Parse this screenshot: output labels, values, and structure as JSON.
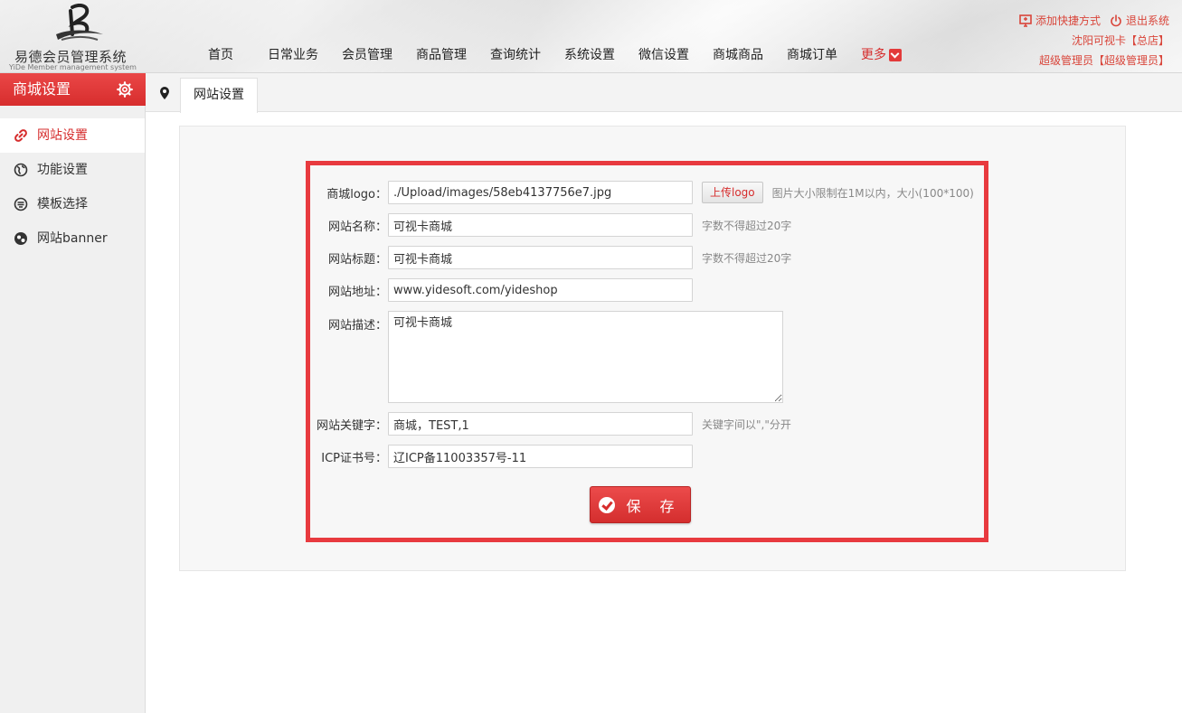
{
  "brand": {
    "name": "易德会员管理系统",
    "subtitle": "YiDe Member management system"
  },
  "nav": {
    "items": [
      "首页",
      "日常业务",
      "会员管理",
      "商品管理",
      "查询统计",
      "系统设置",
      "微信设置",
      "商城商品",
      "商城订单"
    ],
    "more_label": "更多"
  },
  "top_right": {
    "shortcut_label": "添加快捷方式",
    "logout_label": "退出系统",
    "store": "沈阳可视卡【总店】",
    "user": "超级管理员【超级管理员】"
  },
  "sidebar": {
    "title": "商城设置",
    "items": [
      {
        "label": "网站设置",
        "icon": "link-icon",
        "active": true
      },
      {
        "label": "功能设置",
        "icon": "globe-icon",
        "active": false
      },
      {
        "label": "模板选择",
        "icon": "template-icon",
        "active": false
      },
      {
        "label": "网站banner",
        "icon": "banner-icon",
        "active": false
      }
    ]
  },
  "tabs": {
    "current": "网站设置"
  },
  "form": {
    "logo": {
      "label": "商城logo：",
      "value": "./Upload/images/58eb4137756e7.jpg",
      "upload_label": "上传logo",
      "hint": "图片大小限制在1M以内，大小(100*100)"
    },
    "site_name": {
      "label": "网站名称：",
      "value": "可视卡商城",
      "hint": "字数不得超过20字"
    },
    "site_title": {
      "label": "网站标题：",
      "value": "可视卡商城",
      "hint": "字数不得超过20字"
    },
    "site_url": {
      "label": "网站地址：",
      "value": "www.yidesoft.com/yideshop"
    },
    "site_desc": {
      "label": "网站描述：",
      "value": "可视卡商城"
    },
    "keywords": {
      "label": "网站关键字：",
      "value": "商城，TEST,1",
      "hint": "关键字间以\",\"分开"
    },
    "icp": {
      "label": "ICP证书号：",
      "value": "辽ICP备11003357号-11"
    },
    "save_label": "保 存"
  },
  "colors": {
    "accent": "#e53333",
    "highlight_border": "#e83a3f"
  }
}
